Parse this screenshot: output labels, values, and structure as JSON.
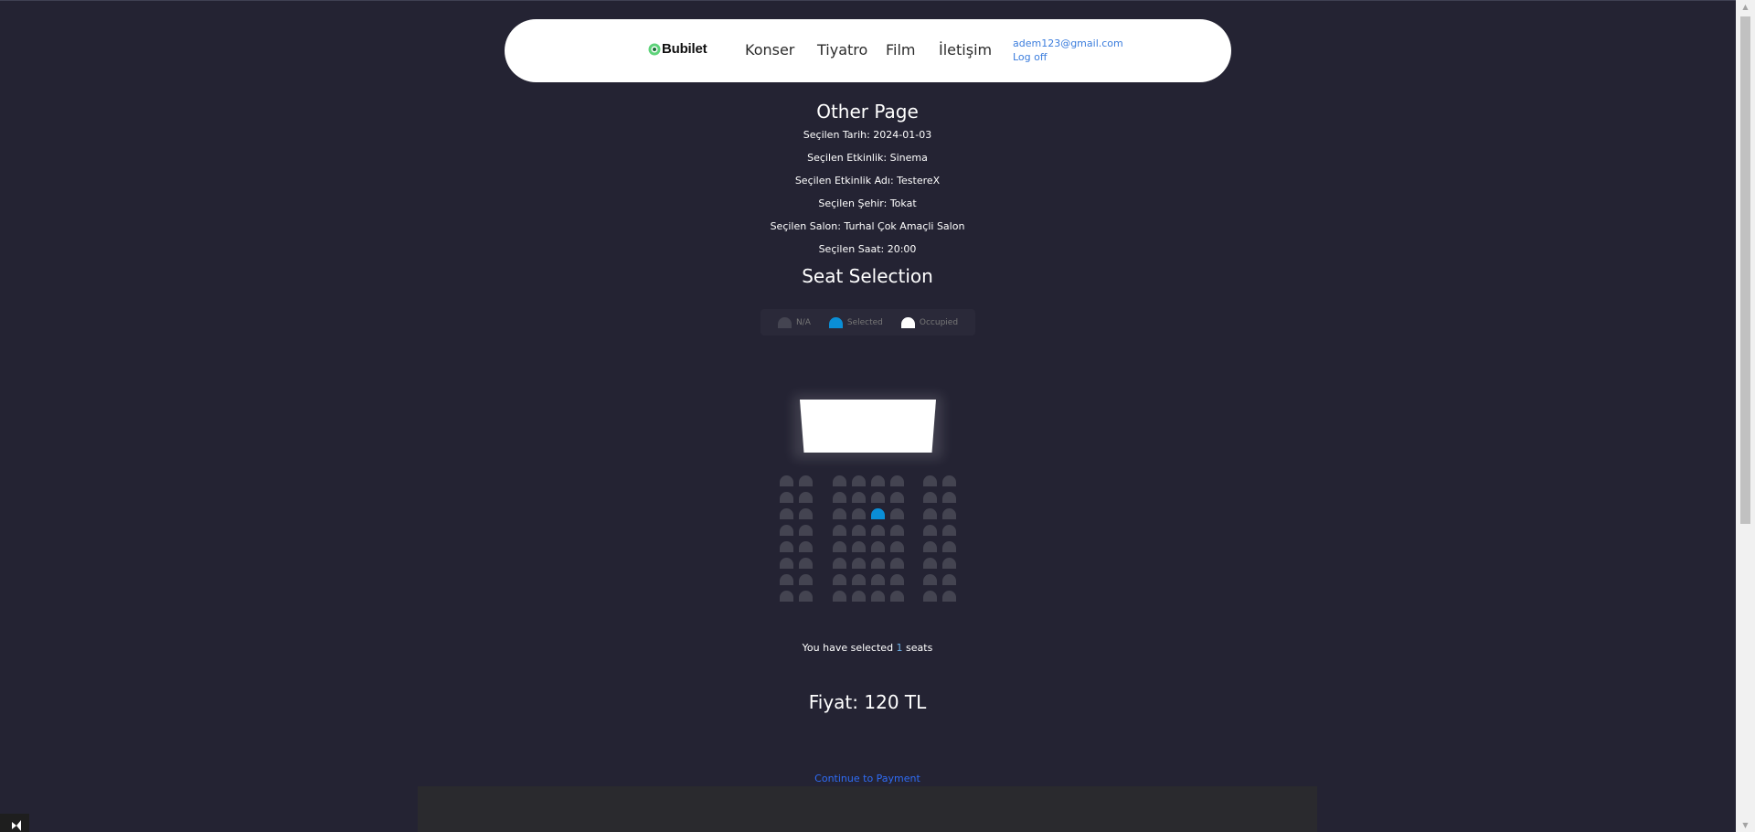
{
  "navbar": {
    "brand": "Bubilet",
    "links": [
      "Konser",
      "Tiyatro",
      "Film",
      "İletişim"
    ],
    "user_email": "adem123@gmail.com",
    "logoff_label": "Log off"
  },
  "page": {
    "title": "Other Page",
    "info": [
      "Seçilen Tarih: 2024-01-03",
      "Seçilen Etkinlik: Sinema",
      "Seçilen Etkinlik Adı: TestereX",
      "Seçilen Şehir: Tokat",
      "Seçilen Salon: Turhal Çok Amaçli Salon",
      "Seçilen Saat: 20:00"
    ],
    "seat_title": "Seat Selection"
  },
  "legend": {
    "na": "N/A",
    "selected": "Selected",
    "occupied": "Occupied"
  },
  "seating": {
    "rows": 8,
    "cols": 10,
    "selected": [
      [
        2,
        4
      ]
    ]
  },
  "summary": {
    "text_prefix": "You have selected ",
    "count": "1",
    "text_suffix": " seats",
    "price": "Fiyat: 120 TL",
    "continue_label": "Continue to Payment"
  },
  "colors": {
    "background": "#242333",
    "seat_available": "#444451",
    "seat_selected": "#0a8ed6",
    "seat_occupied": "#ffffff",
    "link": "#2f6cf6"
  }
}
